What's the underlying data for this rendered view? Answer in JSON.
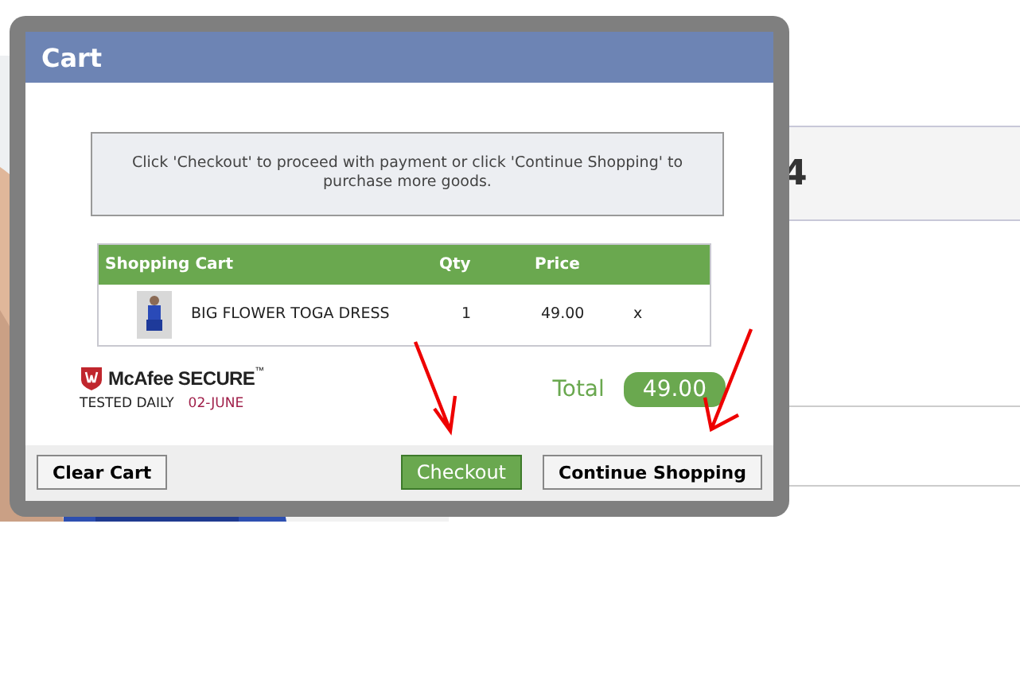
{
  "background": {
    "price_fragment": "4"
  },
  "dialog": {
    "title": "Cart",
    "message": "Click 'Checkout' to proceed with payment or click 'Continue Shopping' to purchase more goods.",
    "cart": {
      "columns": [
        "Shopping Cart",
        "Qty",
        "Price"
      ],
      "rows": [
        {
          "name": "BIG FLOWER TOGA DRESS",
          "qty": "1",
          "price": "49.00",
          "remove": "x"
        }
      ]
    },
    "badge": {
      "brand": "McAfee SECURE",
      "trademark": "™",
      "tested": "TESTED DAILY",
      "date": "02-JUNE"
    },
    "total": {
      "label": "Total",
      "value": "49.00"
    },
    "buttons": [
      {
        "label": "Clear Cart",
        "kind": "plain"
      },
      {
        "label": "Checkout",
        "kind": "primary"
      },
      {
        "label": "Continue Shopping",
        "kind": "plain"
      }
    ]
  }
}
